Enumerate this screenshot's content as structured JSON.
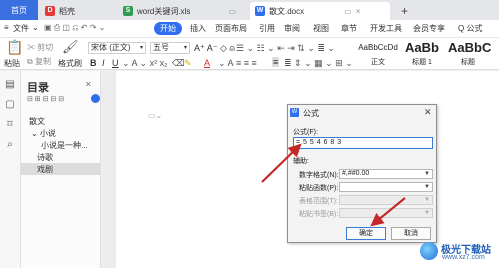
{
  "tabs": {
    "home": "首页",
    "tab1": "稻壳",
    "tab2": "word关键词.xls",
    "tab3": "散文.docx",
    "add": "+"
  },
  "menu": {
    "file": "文件",
    "items": [
      "开始",
      "插入",
      "页面布局",
      "引用",
      "审阅",
      "视图",
      "章节",
      "开发工具",
      "会员专享"
    ],
    "search": "Q 公式"
  },
  "ribbon": {
    "paste": "粘贴",
    "cut": "剪切",
    "copy": "复制",
    "format_painter": "格式刷",
    "font_name": "宋体 (正文)",
    "font_size": "五号",
    "style1_preview": "AaBbCcDd",
    "style1_label": "正文",
    "style2_preview": "AaBb",
    "style2_label": "标题 1",
    "style3_preview": "AaBbC",
    "style3_label": "标题"
  },
  "toc": {
    "title": "目录",
    "items": [
      "散文",
      "小说",
      "小说是一种...",
      "诗歌",
      "戏剧"
    ]
  },
  "dialog": {
    "title": "公式",
    "formula_label": "公式(F):",
    "formula_value": "= 5 5 4 6 8 3",
    "aux_label": "辅助:",
    "number_format_label": "数字格式(N):",
    "number_format_value": "#,##0.00",
    "paste_function_label": "粘贴函数(P):",
    "table_range_label": "表格范围(T):",
    "bookmark_label": "粘贴书签(B):",
    "ok": "确定",
    "cancel": "取消"
  },
  "watermark": {
    "title": "极光下载站",
    "url": "www.xz7.com"
  },
  "colors": {
    "accent": "#2f6fed",
    "arrow": "#c62828"
  }
}
